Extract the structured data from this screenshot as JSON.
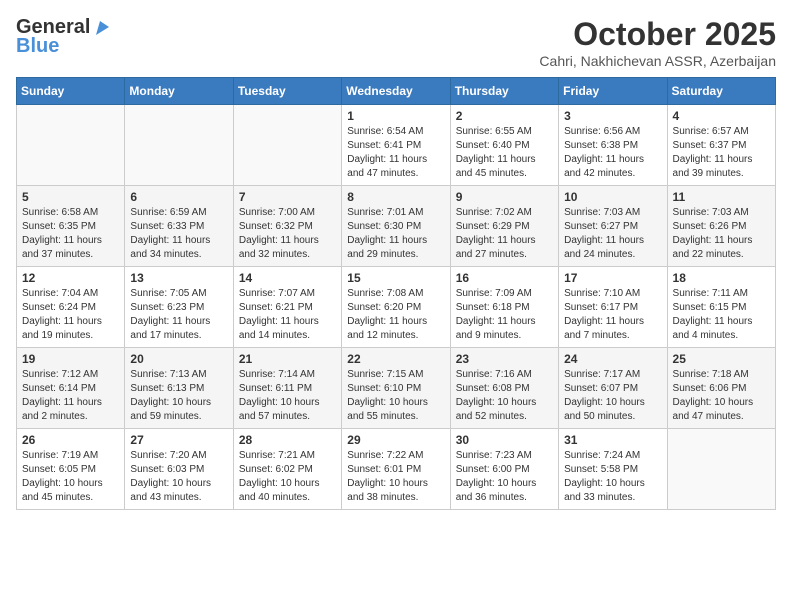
{
  "header": {
    "logo_general": "General",
    "logo_blue": "Blue",
    "month_title": "October 2025",
    "location": "Cahri, Nakhichevan ASSR, Azerbaijan"
  },
  "days_of_week": [
    "Sunday",
    "Monday",
    "Tuesday",
    "Wednesday",
    "Thursday",
    "Friday",
    "Saturday"
  ],
  "weeks": [
    [
      {
        "day": "",
        "info": ""
      },
      {
        "day": "",
        "info": ""
      },
      {
        "day": "",
        "info": ""
      },
      {
        "day": "1",
        "info": "Sunrise: 6:54 AM\nSunset: 6:41 PM\nDaylight: 11 hours\nand 47 minutes."
      },
      {
        "day": "2",
        "info": "Sunrise: 6:55 AM\nSunset: 6:40 PM\nDaylight: 11 hours\nand 45 minutes."
      },
      {
        "day": "3",
        "info": "Sunrise: 6:56 AM\nSunset: 6:38 PM\nDaylight: 11 hours\nand 42 minutes."
      },
      {
        "day": "4",
        "info": "Sunrise: 6:57 AM\nSunset: 6:37 PM\nDaylight: 11 hours\nand 39 minutes."
      }
    ],
    [
      {
        "day": "5",
        "info": "Sunrise: 6:58 AM\nSunset: 6:35 PM\nDaylight: 11 hours\nand 37 minutes."
      },
      {
        "day": "6",
        "info": "Sunrise: 6:59 AM\nSunset: 6:33 PM\nDaylight: 11 hours\nand 34 minutes."
      },
      {
        "day": "7",
        "info": "Sunrise: 7:00 AM\nSunset: 6:32 PM\nDaylight: 11 hours\nand 32 minutes."
      },
      {
        "day": "8",
        "info": "Sunrise: 7:01 AM\nSunset: 6:30 PM\nDaylight: 11 hours\nand 29 minutes."
      },
      {
        "day": "9",
        "info": "Sunrise: 7:02 AM\nSunset: 6:29 PM\nDaylight: 11 hours\nand 27 minutes."
      },
      {
        "day": "10",
        "info": "Sunrise: 7:03 AM\nSunset: 6:27 PM\nDaylight: 11 hours\nand 24 minutes."
      },
      {
        "day": "11",
        "info": "Sunrise: 7:03 AM\nSunset: 6:26 PM\nDaylight: 11 hours\nand 22 minutes."
      }
    ],
    [
      {
        "day": "12",
        "info": "Sunrise: 7:04 AM\nSunset: 6:24 PM\nDaylight: 11 hours\nand 19 minutes."
      },
      {
        "day": "13",
        "info": "Sunrise: 7:05 AM\nSunset: 6:23 PM\nDaylight: 11 hours\nand 17 minutes."
      },
      {
        "day": "14",
        "info": "Sunrise: 7:07 AM\nSunset: 6:21 PM\nDaylight: 11 hours\nand 14 minutes."
      },
      {
        "day": "15",
        "info": "Sunrise: 7:08 AM\nSunset: 6:20 PM\nDaylight: 11 hours\nand 12 minutes."
      },
      {
        "day": "16",
        "info": "Sunrise: 7:09 AM\nSunset: 6:18 PM\nDaylight: 11 hours\nand 9 minutes."
      },
      {
        "day": "17",
        "info": "Sunrise: 7:10 AM\nSunset: 6:17 PM\nDaylight: 11 hours\nand 7 minutes."
      },
      {
        "day": "18",
        "info": "Sunrise: 7:11 AM\nSunset: 6:15 PM\nDaylight: 11 hours\nand 4 minutes."
      }
    ],
    [
      {
        "day": "19",
        "info": "Sunrise: 7:12 AM\nSunset: 6:14 PM\nDaylight: 11 hours\nand 2 minutes."
      },
      {
        "day": "20",
        "info": "Sunrise: 7:13 AM\nSunset: 6:13 PM\nDaylight: 10 hours\nand 59 minutes."
      },
      {
        "day": "21",
        "info": "Sunrise: 7:14 AM\nSunset: 6:11 PM\nDaylight: 10 hours\nand 57 minutes."
      },
      {
        "day": "22",
        "info": "Sunrise: 7:15 AM\nSunset: 6:10 PM\nDaylight: 10 hours\nand 55 minutes."
      },
      {
        "day": "23",
        "info": "Sunrise: 7:16 AM\nSunset: 6:08 PM\nDaylight: 10 hours\nand 52 minutes."
      },
      {
        "day": "24",
        "info": "Sunrise: 7:17 AM\nSunset: 6:07 PM\nDaylight: 10 hours\nand 50 minutes."
      },
      {
        "day": "25",
        "info": "Sunrise: 7:18 AM\nSunset: 6:06 PM\nDaylight: 10 hours\nand 47 minutes."
      }
    ],
    [
      {
        "day": "26",
        "info": "Sunrise: 7:19 AM\nSunset: 6:05 PM\nDaylight: 10 hours\nand 45 minutes."
      },
      {
        "day": "27",
        "info": "Sunrise: 7:20 AM\nSunset: 6:03 PM\nDaylight: 10 hours\nand 43 minutes."
      },
      {
        "day": "28",
        "info": "Sunrise: 7:21 AM\nSunset: 6:02 PM\nDaylight: 10 hours\nand 40 minutes."
      },
      {
        "day": "29",
        "info": "Sunrise: 7:22 AM\nSunset: 6:01 PM\nDaylight: 10 hours\nand 38 minutes."
      },
      {
        "day": "30",
        "info": "Sunrise: 7:23 AM\nSunset: 6:00 PM\nDaylight: 10 hours\nand 36 minutes."
      },
      {
        "day": "31",
        "info": "Sunrise: 7:24 AM\nSunset: 5:58 PM\nDaylight: 10 hours\nand 33 minutes."
      },
      {
        "day": "",
        "info": ""
      }
    ]
  ]
}
